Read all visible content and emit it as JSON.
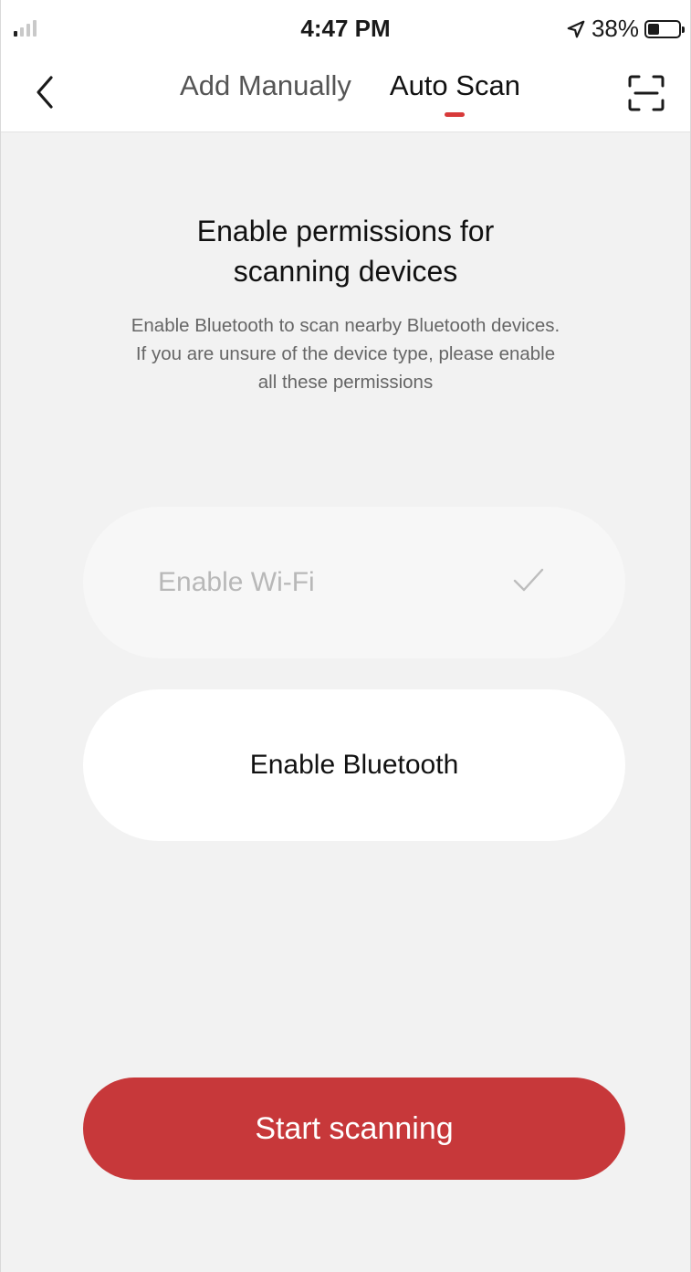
{
  "status_bar": {
    "time": "4:47 PM",
    "battery_text": "38%",
    "battery_level": 0.38,
    "location_icon": "location-arrow-icon"
  },
  "nav": {
    "back_icon": "chevron-left-icon",
    "tabs": [
      {
        "label": "Add Manually",
        "active": false
      },
      {
        "label": "Auto Scan",
        "active": true
      }
    ],
    "scan_icon": "scan-frame-icon"
  },
  "main": {
    "heading_line1": "Enable permissions for",
    "heading_line2": "scanning devices",
    "subtext_line1": "Enable Bluetooth to scan nearby Bluetooth devices.",
    "subtext_line2": "If you are unsure of the device type, please enable",
    "subtext_line3": "all these permissions",
    "permissions": [
      {
        "label": "Enable Wi-Fi",
        "enabled": true,
        "icon": "check-icon"
      },
      {
        "label": "Enable Bluetooth",
        "enabled": false
      }
    ],
    "start_button": "Start scanning"
  },
  "colors": {
    "accent": "#c7383a",
    "tab_indicator": "#d83a3a",
    "background": "#f2f2f2"
  }
}
